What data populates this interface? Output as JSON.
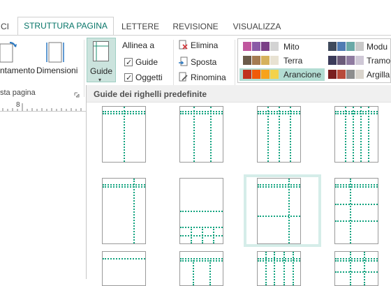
{
  "tabs": [
    "CI",
    "STRUTTURA PAGINA",
    "LETTERE",
    "REVISIONE",
    "VISUALIZZA"
  ],
  "ribbon": {
    "orientation_label": "ntamento",
    "size_label": "Dimensioni",
    "page_setup_group": "sta pagina",
    "guides_label": "Guide",
    "align_title": "Allinea a",
    "align_guides": "Guide",
    "align_objects": "Oggetti",
    "delete_label": "Elimina",
    "move_label": "Sposta",
    "rename_label": "Rinomina"
  },
  "schemes": [
    {
      "name": "Mito",
      "colors": [
        "#c0579e",
        "#8a5aa6",
        "#7b3f87",
        "#d3d3d3"
      ]
    },
    {
      "name": "Terra",
      "colors": [
        "#6b5b4a",
        "#a57c52",
        "#d6b25d",
        "#e8e2d2"
      ]
    },
    {
      "name": "Arancione",
      "colors": [
        "#c0321e",
        "#f05a0a",
        "#f7a21b",
        "#f3d24b"
      ]
    },
    {
      "name": "Modu",
      "colors": [
        "#3f4a5c",
        "#4f7bb3",
        "#6aa9a7",
        "#c9c9c9"
      ]
    },
    {
      "name": "Tramo",
      "colors": [
        "#3b3b5a",
        "#6b5b7a",
        "#8f7ba0",
        "#cfc8d6"
      ]
    },
    {
      "name": "Argilla",
      "colors": [
        "#7a1f1f",
        "#b84a3a",
        "#8d8d8d",
        "#d9d4cc"
      ]
    }
  ],
  "ruler": {
    "label": "8"
  },
  "gallery": {
    "title": "Guide dei righelli predefinite"
  },
  "colors": {
    "accent": "#077568",
    "guide": "#12a37f",
    "selection": "#d5ede9"
  }
}
